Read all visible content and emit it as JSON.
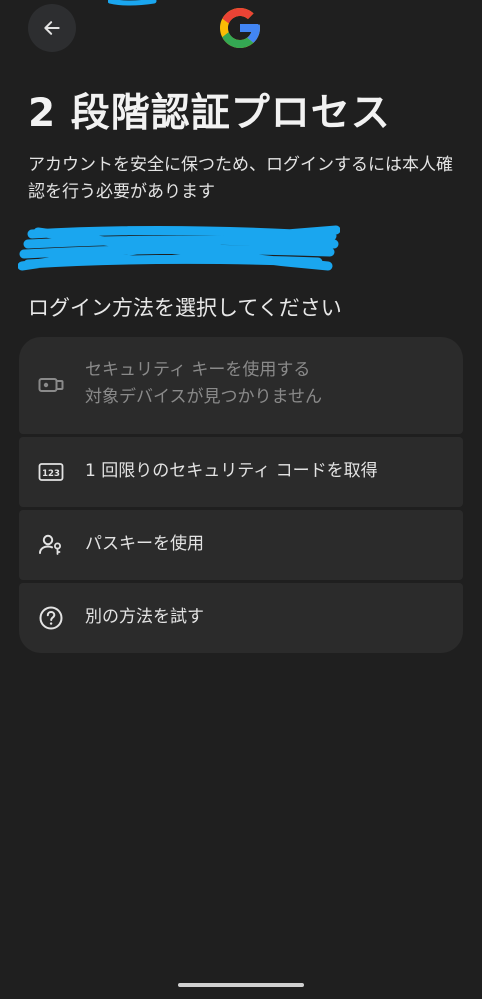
{
  "header": {
    "back_icon": "arrow-back-icon",
    "logo": "google-g-logo",
    "logo_colors": {
      "blue": "#4285F4",
      "red": "#EA4335",
      "yellow": "#FBBC05",
      "green": "#34A853"
    }
  },
  "redaction_color": "#1aa6ef",
  "title": "2 段階認証プロセス",
  "description": "アカウントを安全に保つため、ログインするには本人確認を行う必要があります",
  "section_heading": "ログイン方法を選択してください",
  "options": [
    {
      "icon": "security-key-icon",
      "label": "セキュリティ キーを使用する",
      "sublabel": "対象デバイスが見つかりません",
      "disabled": true
    },
    {
      "icon": "code-123-icon",
      "label": "1 回限りのセキュリティ コードを取得",
      "disabled": false
    },
    {
      "icon": "passkey-icon",
      "label": "パスキーを使用",
      "disabled": false
    },
    {
      "icon": "help-circle-icon",
      "label": "別の方法を試す",
      "disabled": false
    }
  ]
}
